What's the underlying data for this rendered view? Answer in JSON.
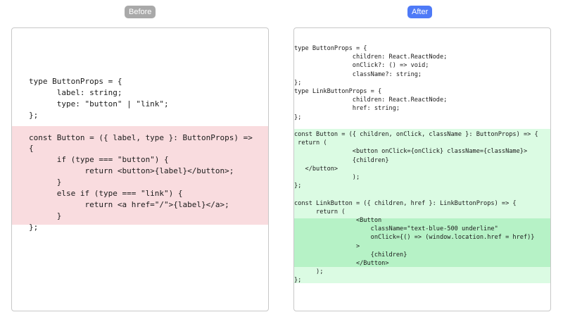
{
  "labels": {
    "before": "Before",
    "after": "After"
  },
  "colors": {
    "before_badge": "#a9a9a9",
    "after_badge": "#4e7af7",
    "removed_bg": "#f9dcdf",
    "added_bg": "#dbfbe3",
    "added_strong_bg": "#b6f2c6"
  },
  "before": {
    "lines": [
      "type ButtonProps = {",
      "      label: string;",
      "      type: \"button\" | \"link\";",
      "};",
      "",
      "const Button = ({ label, type }: ButtonProps) =>",
      "{",
      "      if (type === \"button\") {",
      "            return <button>{label}</button>;",
      "      }",
      "      else if (type === \"link\") {",
      "            return <a href=\"/\">{label}</a>;",
      "      }",
      "};"
    ]
  },
  "after": {
    "lines": [
      "type ButtonProps = {",
      "                children: React.ReactNode;",
      "                onClick?: () => void;",
      "                className?: string;",
      "};",
      "type LinkButtonProps = {",
      "                children: React.ReactNode;",
      "                href: string;",
      "};",
      "",
      "const Button = ({ children, onClick, className }: ButtonProps) => {",
      " return (",
      "                <button onClick={onClick} className={className}>",
      "                {children}",
      "   </button>",
      "                );",
      "};",
      "",
      "const LinkButton = ({ children, href }: LinkButtonProps) => {",
      "      return (",
      "                 <Button",
      "                     className=\"text-blue-500 underline\"",
      "                     onClick={() => (window.location.href = href)}",
      "                 >",
      "                     {children}",
      "                 </Button>",
      "      );",
      "};"
    ]
  }
}
